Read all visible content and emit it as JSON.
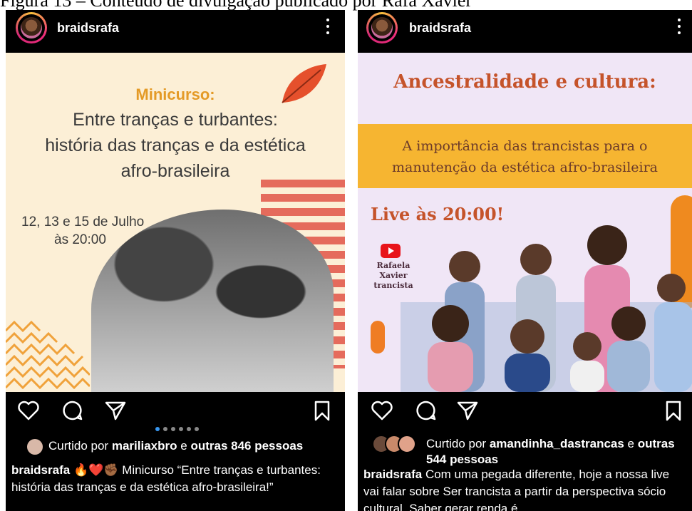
{
  "figure_caption": "Figura 13 – Conteúdo de divulgação publicado por Rafa Xavier",
  "colors": {
    "background": "#000000",
    "text": "#ffffff",
    "carousel_active": "#3897f0"
  },
  "posts": [
    {
      "username": "braidsrafa",
      "media": {
        "subtitle": "Minicurso:",
        "title_lines": [
          "Entre tranças e turbantes:",
          "história das tranças e da estética",
          "afro-brasileira"
        ],
        "date_line1": "12, 13 e 15 de Julho",
        "date_line2": "às 20:00"
      },
      "carousel": {
        "count": 6,
        "active": 1
      },
      "likes": {
        "prefix": "Curtido por",
        "user": "mariliaxbro",
        "middle": "e",
        "others": "outras 846 pessoas"
      },
      "caption": {
        "user": "braidsrafa",
        "emoji": "🔥❤️✊🏾",
        "text": "Minicurso “Entre tranças e turbantes: história das tranças e da estética afro-brasileira!”"
      },
      "icons": [
        "heart-icon",
        "comment-icon",
        "share-icon",
        "bookmark-icon",
        "more-icon"
      ]
    },
    {
      "username": "braidsrafa",
      "media": {
        "title": "Ancestralidade e cultura:",
        "band_lines": [
          "A importância das trancistas para o",
          "manutenção da estética afro-brasileira"
        ],
        "live": "Live às 20:00!",
        "speaker_name": "Rafaela Xavier",
        "speaker_role": "trancista"
      },
      "likes": {
        "prefix": "Curtido por",
        "user": "amandinha_dastrancas",
        "middle": "e",
        "others": "outras 544 pessoas"
      },
      "caption": {
        "user": "braidsrafa",
        "text": "Com uma pegada diferente, hoje a nossa live vai falar sobre Ser trancista a partir da perspectiva sócio cultural. Saber gerar renda é"
      },
      "icons": [
        "heart-icon",
        "comment-icon",
        "share-icon",
        "bookmark-icon",
        "more-icon"
      ]
    }
  ]
}
